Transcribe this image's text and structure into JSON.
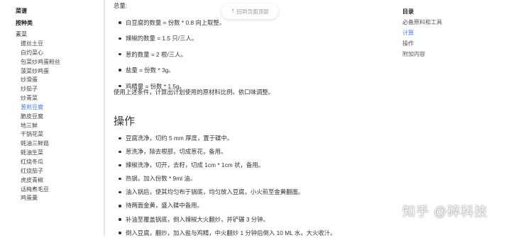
{
  "sidebar": {
    "heading": "菜谱",
    "category": "按种类",
    "group": "素菜",
    "items": [
      {
        "label": "拔丝土豆",
        "active": false
      },
      {
        "label": "白灼菜心",
        "active": false
      },
      {
        "label": "包菜炒鸡蛋粉丝",
        "active": false
      },
      {
        "label": "菠菜炒鸡蛋",
        "active": false
      },
      {
        "label": "炒滑蛋",
        "active": false
      },
      {
        "label": "炒茄子",
        "active": false
      },
      {
        "label": "炒青菜",
        "active": false
      },
      {
        "label": "葱煎豆腐",
        "active": true
      },
      {
        "label": "脆皮豆腐",
        "active": false
      },
      {
        "label": "地三鲜",
        "active": false
      },
      {
        "label": "干锅花菜",
        "active": false
      },
      {
        "label": "蚝油三鲜菇",
        "active": false
      },
      {
        "label": "蚝油生菜",
        "active": false
      },
      {
        "label": "红烧冬瓜",
        "active": false
      },
      {
        "label": "红烧茄子",
        "active": false
      },
      {
        "label": "虎皮青椒",
        "active": false
      },
      {
        "label": "话梅煮毛豆",
        "active": false
      },
      {
        "label": "鸡蛋羹",
        "active": false
      }
    ]
  },
  "main": {
    "total_label": "总量:",
    "quantities": [
      "白豆腐的数量 = 份数 * 0.8 向上取整。",
      "辣椒的数量 = 1.5 只/三人。",
      "葱的数量 = 2 根/三人。",
      "盐量 = 份数 * 3g。",
      "鸡精量 = 份数 * 1.5g。"
    ],
    "note": "使用上述条件，计算出计划使用的原材料比例。依口味调整。",
    "section_title": "操作",
    "steps": [
      "豆腐洗净，切约 5 mm 厚度，置于碟中。",
      "葱洗净，除去根部，切成葱花，备用。",
      "辣椒洗净，切开，去籽，切成 1cm * 1cm 状，备用。",
      "热锅，加入份数 * 9ml 油。",
      "油入锅后，使其均匀布于锅底，均匀放入豆腐，小火煎至金黄翻面。",
      "待两面金黄，盛入碟中备用。",
      "补油至覆盖锅底，倒入辣椒大火翻炒，并铲碾 3 分钟。",
      "倒入豆腐，翻炒，加入盐与鸡精，中火翻炒 1 分钟后倒入 10 ML 水，大火收汁。"
    ]
  },
  "back_to_top": {
    "label": "回到页面顶部",
    "icon": "arrow-up-icon"
  },
  "toc": {
    "title": "目录",
    "items": [
      {
        "label": "必备原料和工具",
        "active": false
      },
      {
        "label": "计算",
        "active": true
      },
      {
        "label": "操作",
        "active": false
      },
      {
        "label": "附加内容",
        "active": false
      }
    ]
  },
  "watermark": {
    "text": "知乎 @碎科技"
  },
  "colors": {
    "accent": "#3f7ff5",
    "text": "#333333",
    "muted": "#999999"
  }
}
